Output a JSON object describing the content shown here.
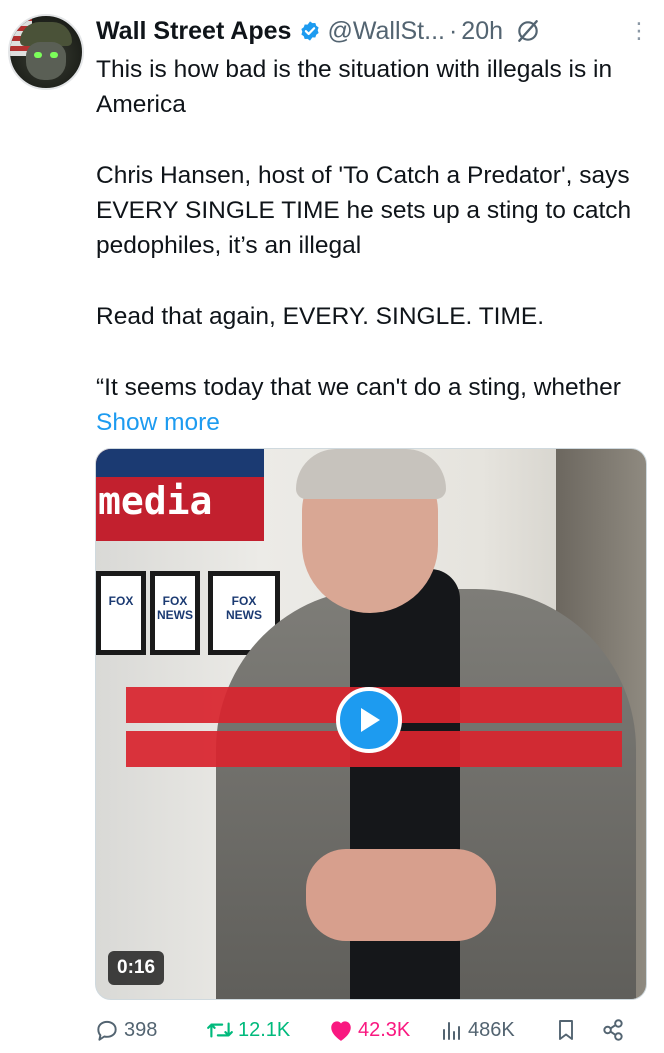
{
  "author": {
    "name": "Wall Street Apes",
    "handle": "@WallSt...",
    "separator": "·",
    "time": "20h"
  },
  "tweet": {
    "paragraphs": [
      "This is how bad is the situation with illegals is in America",
      "Chris Hansen, host of 'To Catch a Predator', says EVERY SINGLE TIME he sets up a sting to catch pedophiles, it’s an illegal",
      "Read that again, EVERY. SINGLE. TIME."
    ],
    "last_line": "“It seems today that we can't do a sting, whether",
    "show_more": "Show more"
  },
  "media": {
    "duration": "0:16",
    "sign_text": "media",
    "logo_labels": [
      "FOX",
      "FOX NEWS",
      "FOX NEWS"
    ]
  },
  "actions": {
    "replies": "398",
    "reposts": "12.1K",
    "likes": "42.3K",
    "views": "486K"
  },
  "colors": {
    "accent": "#1d9bf0",
    "repost": "#00ba7c",
    "like": "#f91880",
    "muted": "#536471"
  },
  "icons": [
    "verified-badge-icon",
    "grok-icon",
    "more-icon",
    "play-icon",
    "reply-icon",
    "repost-icon",
    "like-icon",
    "views-icon",
    "bookmark-icon",
    "share-icon"
  ]
}
